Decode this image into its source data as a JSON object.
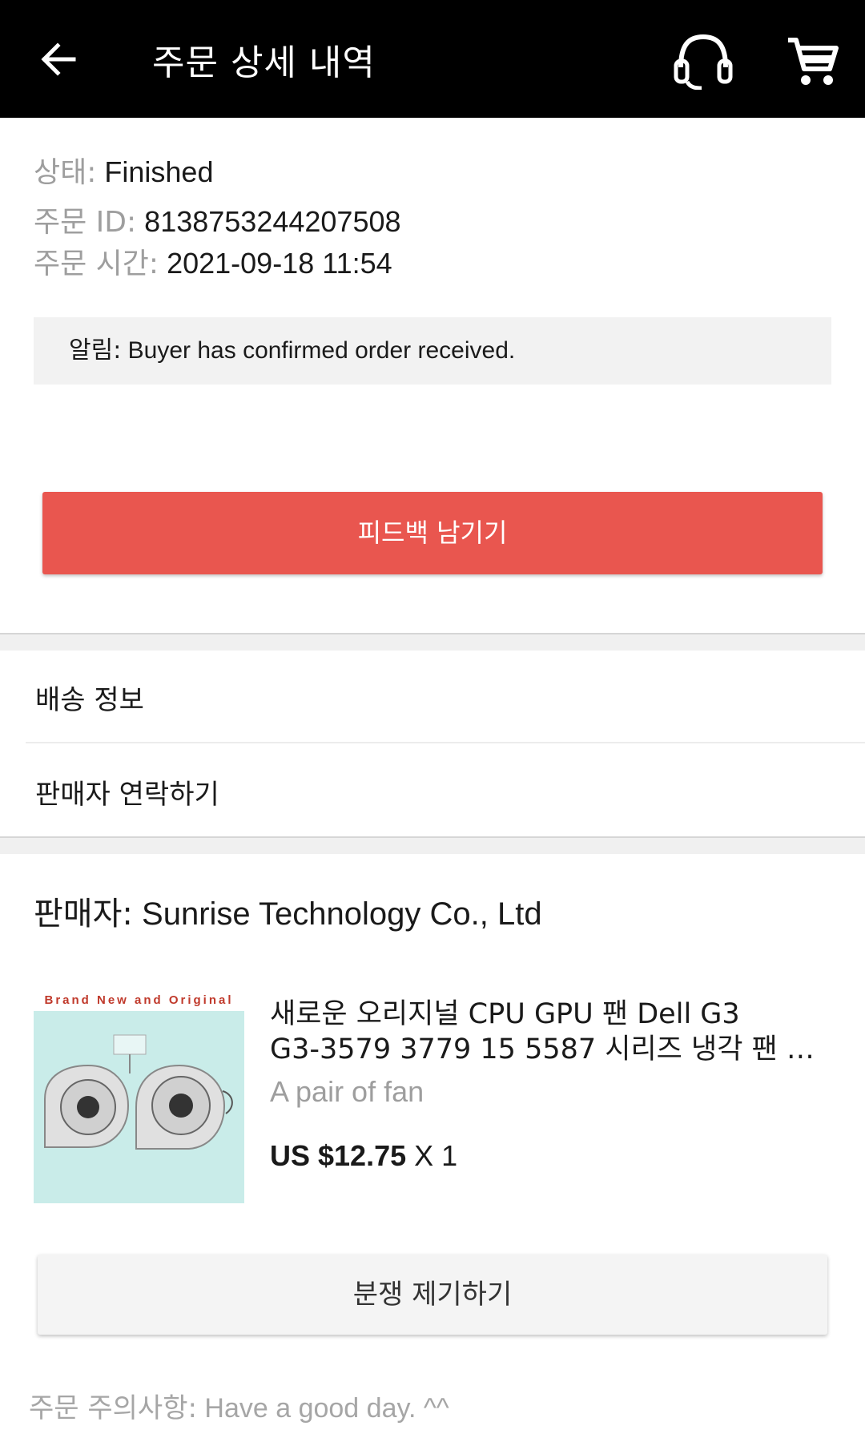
{
  "header": {
    "title": "주문 상세 내역",
    "icons": [
      "back-arrow-icon",
      "headset-support-icon",
      "shopping-cart-icon"
    ]
  },
  "order": {
    "status_label": "상태:",
    "status_value": "Finished",
    "id_label": "주문 ID:",
    "id_value": "8138753244207508",
    "time_label": "주문 시간:",
    "time_value": "2021-09-18 11:54"
  },
  "notice": {
    "label": "알림:",
    "text": "Buyer has confirmed order received."
  },
  "actions": {
    "feedback_label": "피드백 남기기",
    "dispute_label": "분쟁 제기하기"
  },
  "menu": {
    "shipping_info": "배송 정보",
    "contact_seller": "판매자 연락하기"
  },
  "seller": {
    "label": "판매자:",
    "name": "Sunrise Technology Co., Ltd"
  },
  "product": {
    "image_banner": "Brand New and Original",
    "title_line1": "새로운 오리지널 CPU GPU 팬 Dell G3",
    "title_line2": "G3-3579 3779 15 5587 시리즈 냉각 팬 쿨...",
    "variant": "A pair of fan",
    "price": "US $12.75",
    "quantity": "X 1"
  },
  "footer": {
    "note_label": "주문 주의사항:",
    "note_text": "Have a good day. ^^"
  },
  "colors": {
    "appbar": "#000000",
    "accent_button": "#e9564f",
    "muted_text": "#9e9e9e",
    "notice_bg": "#f2f2f2"
  }
}
